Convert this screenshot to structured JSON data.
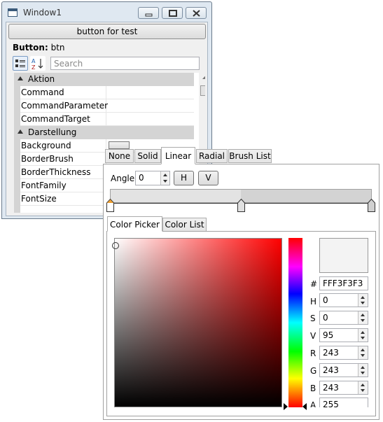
{
  "window": {
    "title": "Window1",
    "test_button": "button for test",
    "selected_label": "Button:",
    "selected_name": "btn",
    "search_placeholder": "Search",
    "categories": [
      {
        "name": "Aktion",
        "properties": [
          "Command",
          "CommandParameter",
          "CommandTarget"
        ]
      },
      {
        "name": "Darstellung",
        "properties": [
          "Background",
          "BorderBrush",
          "BorderThickness",
          "FontFamily",
          "FontSize"
        ]
      }
    ]
  },
  "brush_editor": {
    "tabs": [
      "None",
      "Solid",
      "Linear",
      "Radial",
      "Brush List"
    ],
    "active_tab": "Linear",
    "angle_label": "Angle",
    "angle_value": "0",
    "h_button": "H",
    "v_button": "V",
    "color_tabs": [
      "Color Picker",
      "Color List"
    ],
    "hex_label": "#",
    "hex_value": "FFF3F3F3",
    "fields": [
      {
        "label": "H",
        "value": "0"
      },
      {
        "label": "S",
        "value": "0"
      },
      {
        "label": "V",
        "value": "95"
      },
      {
        "label": "R",
        "value": "243"
      },
      {
        "label": "G",
        "value": "243"
      },
      {
        "label": "B",
        "value": "243"
      },
      {
        "label": "A",
        "value": "255"
      }
    ],
    "preview_color": "#F3F3F3",
    "accent_stop_color": "#F0A030"
  }
}
